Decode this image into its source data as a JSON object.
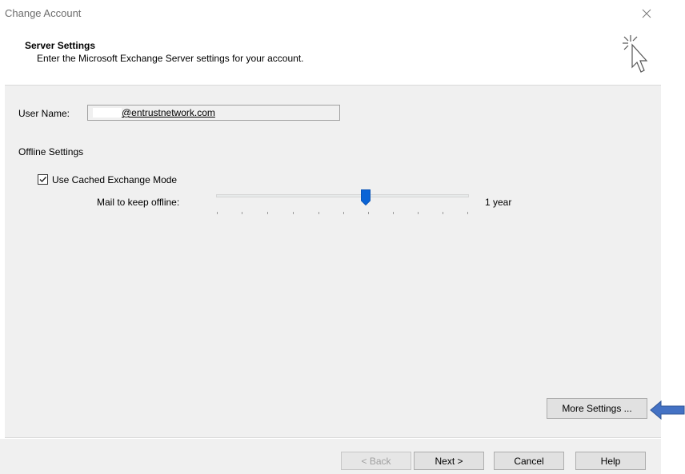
{
  "window": {
    "title": "Change Account"
  },
  "header": {
    "title": "Server Settings",
    "subtitle": "Enter the Microsoft Exchange Server settings for your account."
  },
  "account": {
    "user_name_label": "User Name:",
    "user_name_value": "@entrustnetwork.com"
  },
  "offline": {
    "section_title": "Offline Settings",
    "cached_mode_label": "Use Cached Exchange Mode",
    "cached_mode_checked": true,
    "mail_offline_label": "Mail to keep offline:",
    "mail_offline_value": "1 year",
    "slider_position_fraction": 0.6
  },
  "buttons": {
    "more_settings": "More Settings ...",
    "back": "< Back",
    "next": "Next >",
    "cancel": "Cancel",
    "help": "Help"
  },
  "colors": {
    "accent": "#0a64d6",
    "annotation_arrow": "#4472c4"
  },
  "icons": {
    "close": "close-icon",
    "wizard": "cursor-sparkle-icon"
  }
}
